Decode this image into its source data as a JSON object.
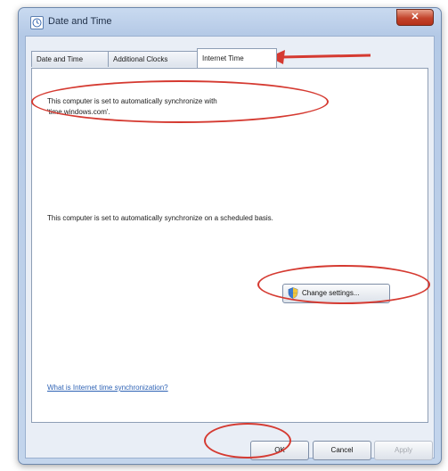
{
  "window": {
    "title": "Date and Time",
    "close_label": "✕"
  },
  "tabs": [
    {
      "label": "Date and Time",
      "active": false
    },
    {
      "label": "Additional Clocks",
      "active": false
    },
    {
      "label": "Internet Time",
      "active": true
    }
  ],
  "internet_time": {
    "sync_line1": "This computer is set to automatically synchronize with",
    "sync_line2": "'time.windows.com'.",
    "schedule_text": "This computer is set to automatically synchronize on a scheduled basis.",
    "change_settings_label": "Change settings...",
    "help_link": "What is Internet time synchronization?"
  },
  "footer": {
    "ok_label": "OK",
    "cancel_label": "Cancel",
    "apply_label": "Apply"
  },
  "colors": {
    "annotation": "#d53a31",
    "link": "#2f63b5"
  }
}
